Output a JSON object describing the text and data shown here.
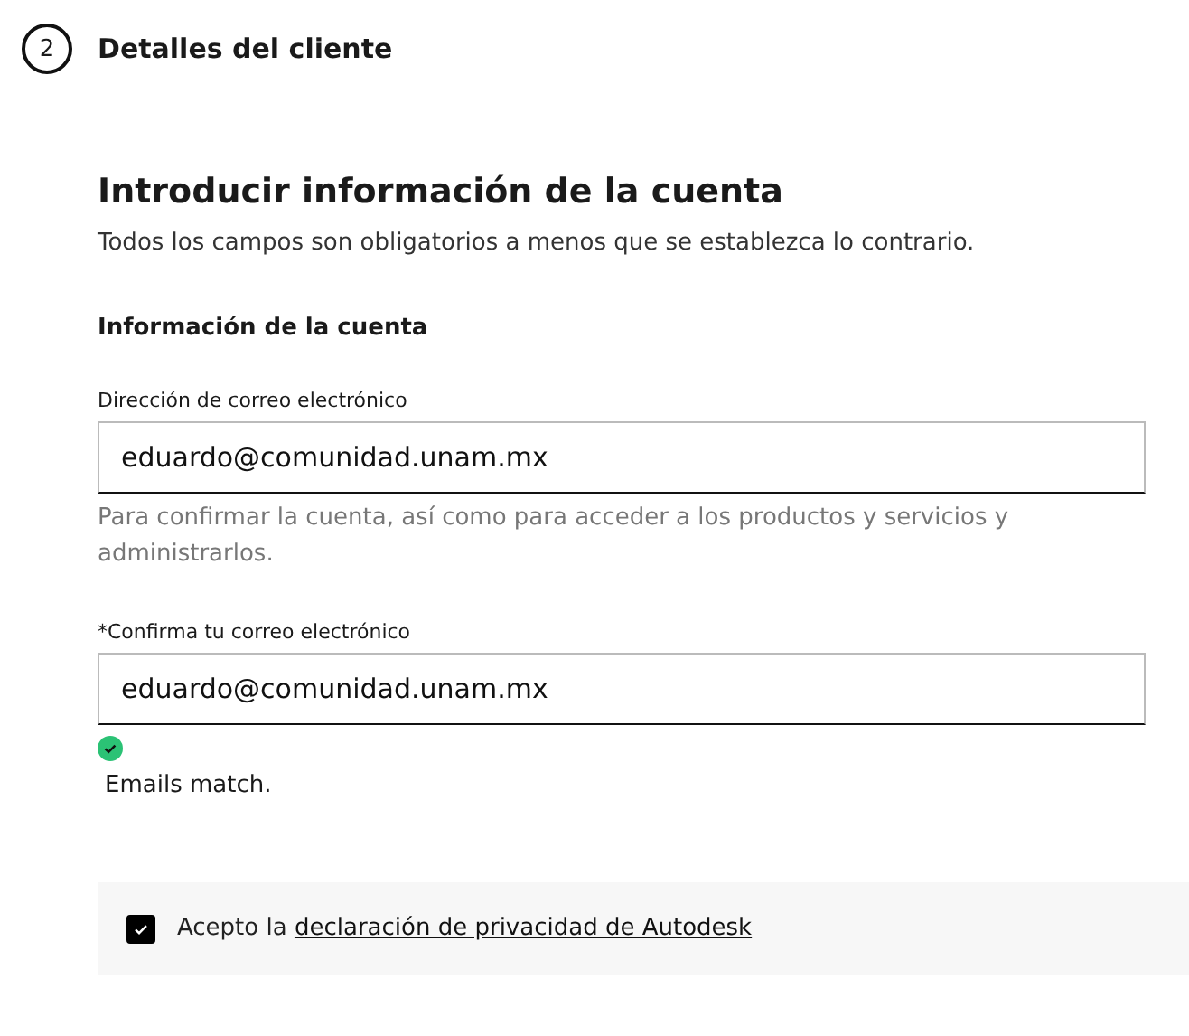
{
  "step": {
    "number": "2",
    "title": "Detalles del cliente"
  },
  "heading": "Introducir información de la cuenta",
  "intro": "Todos los campos son obligatorios a menos que se establezca lo contrario.",
  "section_title": "Información de la cuenta",
  "fields": [
    {
      "label": "Dirección de correo electrónico",
      "value": "eduardo@comunidad.unam.mx",
      "helper": "Para confirmar la cuenta, así como para acceder a los productos y servicios y administrarlos."
    },
    {
      "label": "*Confirma tu correo electrónico",
      "value": "eduardo@comunidad.unam.mx",
      "validation": {
        "kind": "success",
        "text": "Emails match."
      }
    }
  ],
  "consent": {
    "checked": true,
    "text": "Acepto la",
    "link": "declaración de privacidad de Autodesk"
  }
}
